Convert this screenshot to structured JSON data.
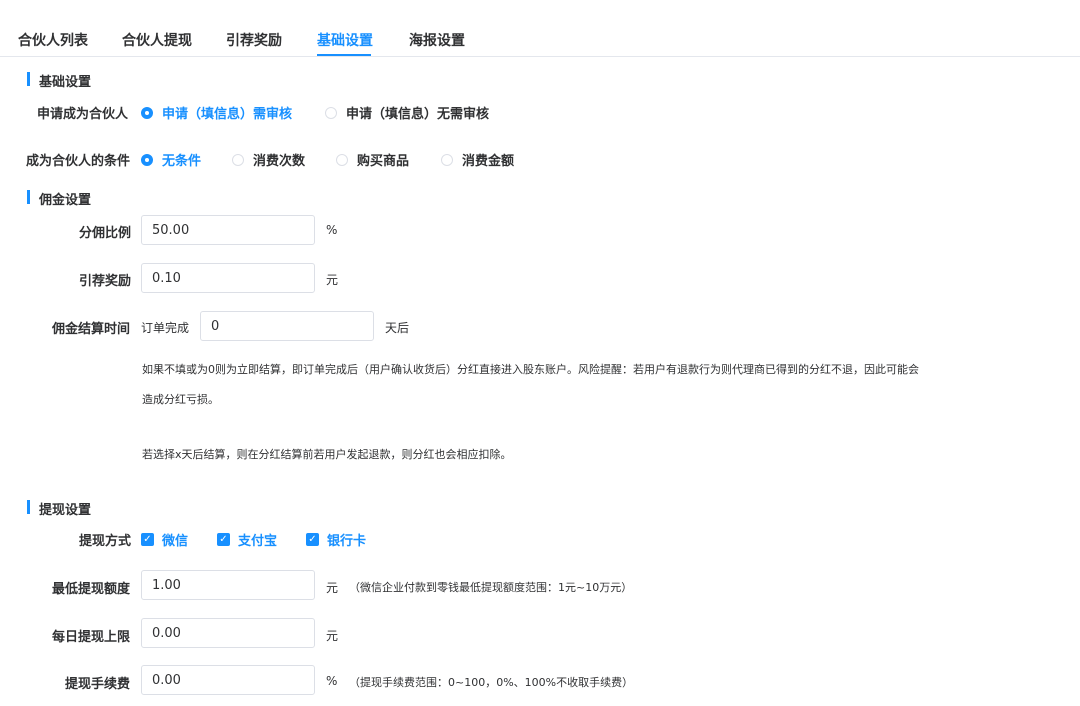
{
  "tabs": [
    {
      "label": "合伙人列表"
    },
    {
      "label": "合伙人提现"
    },
    {
      "label": "引荐奖励"
    },
    {
      "label": "基础设置"
    },
    {
      "label": "海报设置"
    }
  ],
  "active_tab": "基础设置",
  "basic": {
    "title": "基础设置",
    "apply": {
      "label": "申请成为合伙人",
      "options": [
        "申请（填信息）需审核",
        "申请（填信息）无需审核"
      ],
      "selected": "申请（填信息）需审核"
    },
    "condition": {
      "label": "成为合伙人的条件",
      "options": [
        "无条件",
        "消费次数",
        "购买商品",
        "消费金额"
      ],
      "selected": "无条件"
    }
  },
  "commission": {
    "title": "佣金设置",
    "ratio": {
      "label": "分佣比例",
      "value": "50.00",
      "unit": "%"
    },
    "referral": {
      "label": "引荐奖励",
      "value": "0.10",
      "unit": "元"
    },
    "settle": {
      "label": "佣金结算时间",
      "prefix": "订单完成",
      "value": "0",
      "unit": "天后"
    },
    "note_1a": "如果不填或为0则为立即结算，即订单完成后（用户确认收货后）分红直接进入股东账户。风险提醒：若用户有退款行为则代理商已得到的分红不退，因此可能会",
    "note_1b": "造成分红亏损。",
    "note_2": "若选择x天后结算，则在分红结算前若用户发起退款，则分红也会相应扣除。"
  },
  "withdraw": {
    "title": "提现设置",
    "methods": {
      "label": "提现方式",
      "options": [
        "微信",
        "支付宝",
        "银行卡"
      ]
    },
    "min_amount": {
      "label": "最低提现额度",
      "value": "1.00",
      "unit": "元",
      "note": "（微信企业付款到零钱最低提现额度范围：1元~10万元）"
    },
    "daily_limit": {
      "label": "每日提现上限",
      "value": "0.00",
      "unit": "元"
    },
    "fee": {
      "label": "提现手续费",
      "value": "0.00",
      "unit": "%",
      "note": "（提现手续费范围：0~100，0%、100%不收取手续费）"
    }
  },
  "colors": {
    "accent": "#1890ff",
    "text": "#303133",
    "border": "#dcdfe6"
  }
}
